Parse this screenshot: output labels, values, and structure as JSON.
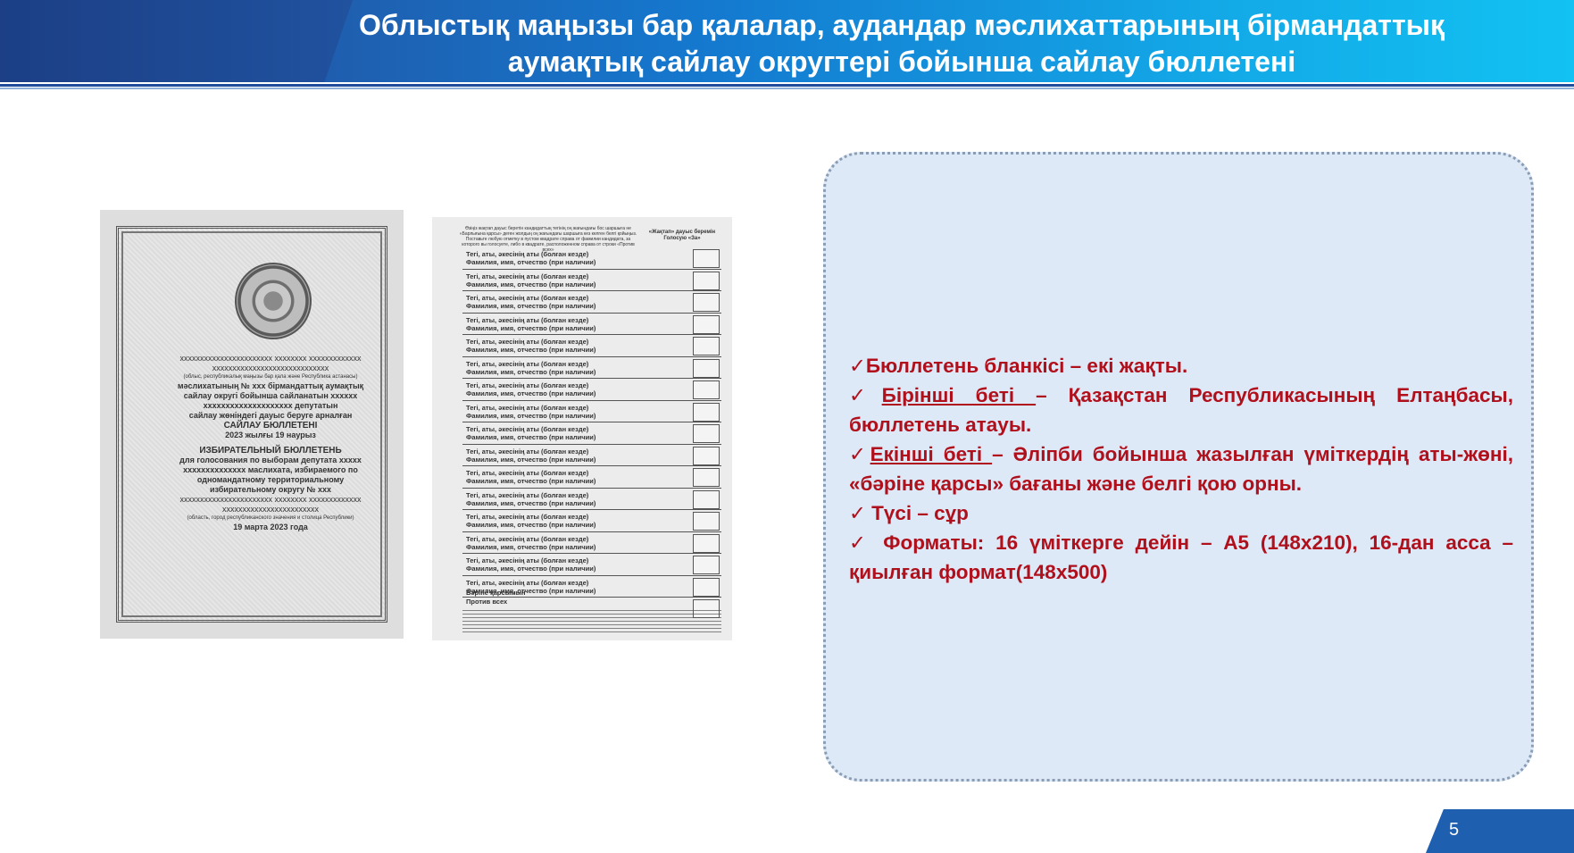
{
  "header": {
    "title_line1": "Облыстық маңызы бар қалалар, аудандар мәслихаттарының бірмандаттық",
    "title_line2": "аумақтық сайлау округтері бойынша сайлау бюллетені"
  },
  "ballot_front": {
    "lines": [
      "ххххххххххххххххххххххх хххххххх ххххххххххххх",
      "ххххххххххххххххххххххххххххх",
      "(облыс, республикалық маңызы бар қала және Республика астанасы)",
      "мәслихатының № ххх бірмандаттық аумақтық",
      "сайлау округі бойынша сайланатын хххххх",
      "хххххххххххххххххххх депутатын",
      "сайлау жөніндегі дауыс беруге арналған",
      "САЙЛАУ БЮЛЛЕТЕНІ",
      "2023 жылғы 19 наурыз",
      "ИЗБИРАТЕЛЬНЫЙ БЮЛЛЕТЕНЬ",
      "для голосования по выборам депутата ххххх",
      "хххххххххххххх маслихата, избираемого по",
      "одномандатному территориальному",
      "избирательному округу № ххх",
      "ххххххххххххххххххххххх хххххххх ххххххххххххх",
      "хххххххххххххххххххххххх",
      "(область, город республиканского значения и столица Республики)",
      "19 марта 2023 года"
    ]
  },
  "ballot_back": {
    "header_left": "Өзіңіз жақтап дауыс беретін кандидаттың тегінің оң жағындағы бос шаршыға не «Барлығына қарсы» деген жолдың оң жағындағы шаршыға кез келген белгі қойыңыз. Поставьте любую отметку в пустом квадрате справа от фамилии кандидата, за которого вы голосуете, либо в квадрате, расположенном справа от строки «Против всех»",
    "header_right_1": "«Жақтап» дауыс беремін",
    "header_right_2": "Голосую «За»",
    "row_label_kk": "Тегі, аты, әкесінің аты (болған кезде)",
    "row_label_ru": "Фамилия, имя, отчество (при наличии)",
    "row_count": 16,
    "against_kk": "Бәріне қарсымын",
    "against_ru": "Против всех"
  },
  "info": {
    "items": [
      {
        "check": "✓",
        "lead": "",
        "text": "Бюллетень бланкісі – екі жақты."
      },
      {
        "check": "✓",
        "lead": "Бірінші беті ",
        "text": "– Қазақстан Республикасының Елтаңбасы, бюллетень атауы."
      },
      {
        "check": "✓",
        "lead": "Екінші беті ",
        "text": "– Әліпби бойынша жазылған үміткердің аты-жөні, «бәріне қарсы» бағаны және белгі қою орны."
      },
      {
        "check": "✓",
        "lead": "",
        "text": " Түсі – сұр"
      },
      {
        "check": "✓",
        "lead": "",
        "text": " Форматы: 16 үміткерге дейін – А5 (148х210), 16-дан асса – қиылған формат(148х500)"
      }
    ],
    "text_color": "#b0101c",
    "panel_color": "#dde9f6"
  },
  "page_number": "5"
}
